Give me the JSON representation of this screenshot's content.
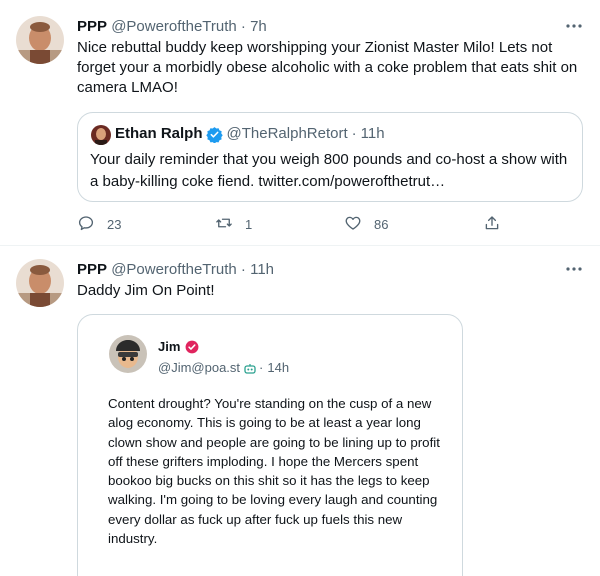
{
  "tweets": [
    {
      "author_name": "PPP",
      "handle": "@PoweroftheTruth",
      "separator": "·",
      "time": "7h",
      "text": "Nice rebuttal buddy keep worshipping your Zionist Master Milo! Lets not forget your a morbidly obese alcoholic with a coke problem that eats shit on camera LMAO!",
      "quote": {
        "author_name": "Ethan Ralph",
        "handle": "@TheRalphRetort",
        "separator": "·",
        "time": "11h",
        "text": "Your daily reminder that you weigh 800 pounds and co-host a show with a baby-killing coke fiend. twitter.com/powerofthetrut…"
      },
      "actions": {
        "reply_count": "23",
        "retweet_count": "1",
        "like_count": "86"
      }
    },
    {
      "author_name": "PPP",
      "handle": "@PoweroftheTruth",
      "separator": "·",
      "time": "11h",
      "text": "Daddy Jim On Point!",
      "embed": {
        "author_name": "Jim",
        "handle": "@Jim@poa.st",
        "separator": "·",
        "time": "14h",
        "text": "Content drought? You're standing on the cusp of a new alog economy. This is going to be at least a year long clown show and people are going to be lining up to profit off these grifters imploding. I hope the Mercers spent bookoo big bucks on this shit so it has the legs to keep walking. I'm going to be loving every laugh and counting every dollar as fuck up after fuck up fuels this new industry."
      }
    }
  ],
  "colors": {
    "text": "#0f1419",
    "secondary": "#536471",
    "border": "#cfd9de",
    "verified_blue": "#1d9bf0",
    "badge_red": "#e0245e"
  },
  "icons": [
    "more-icon",
    "reply-icon",
    "retweet-icon",
    "like-icon",
    "share-icon",
    "verified-icon",
    "bot-icon"
  ]
}
